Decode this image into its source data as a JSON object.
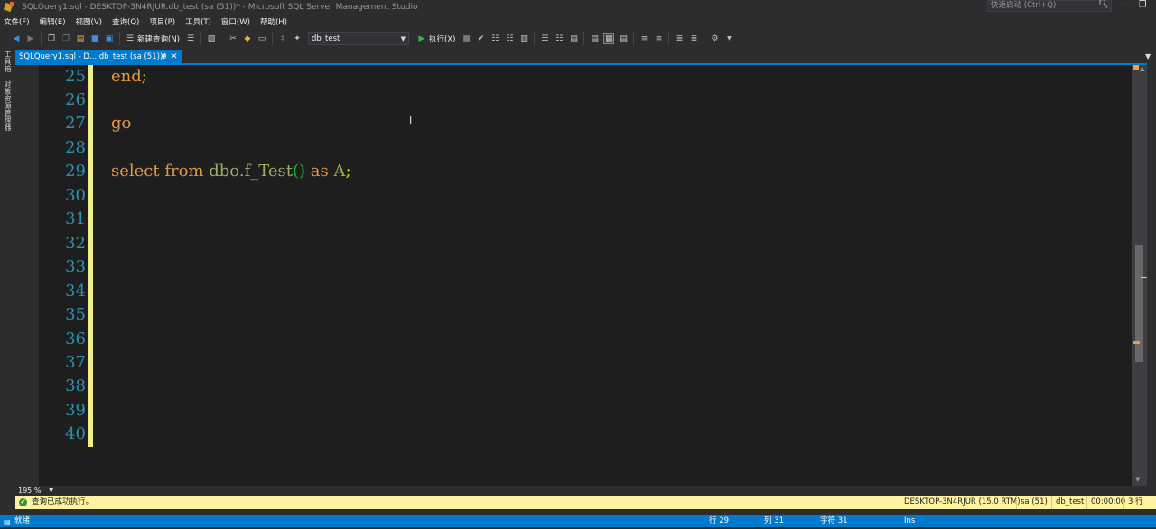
{
  "window": {
    "title": "SQLQuery1.sql - DESKTOP-3N4RJUR.db_test (sa (51))* - Microsoft SQL Server Management Studio",
    "quick_launch_placeholder": "快速启动 (Ctrl+Q)",
    "controls": {
      "minimize": "—",
      "restore": "❐"
    }
  },
  "menu": {
    "items": [
      "文件(F)",
      "编辑(E)",
      "视图(V)",
      "查询(Q)",
      "项目(P)",
      "工具(T)",
      "窗口(W)",
      "帮助(H)"
    ]
  },
  "toolbar": {
    "new_query_label": "新建查询(N)",
    "database_value": "db_test",
    "execute_label": "执行(X)"
  },
  "side_tabs": {
    "toolbox": "工具箱",
    "object_explorer": "对象资源管理器"
  },
  "document_tab": {
    "label": "SQLQuery1.sql - D....db_test (sa (51))*",
    "pin_glyph": "⊕",
    "close_glyph": "✕"
  },
  "editor": {
    "line_numbers": [
      "25",
      "26",
      "27",
      "28",
      "29",
      "30",
      "31",
      "32",
      "33",
      "34",
      "35",
      "36",
      "37",
      "38",
      "39",
      "40"
    ],
    "code": {
      "line25_kw": "end",
      "line25_semi": ";",
      "line27_kw": "go",
      "line29_select": "select",
      "line29_from": "from",
      "line29_obj": "dbo.",
      "line29_fn": "f_Test",
      "line29_parens": "()",
      "line29_as": "as",
      "line29_alias": "A",
      "line29_semi": ";"
    }
  },
  "zoom": {
    "value": "195 %"
  },
  "query_status": {
    "message": "查询已成功执行。",
    "server": "DESKTOP-3N4RJUR (15.0 RTM)",
    "user": "sa (51)",
    "database": "db_test",
    "elapsed": "00:00:00",
    "rows": "3 行"
  },
  "status_bar": {
    "ready": "就绪",
    "line": "行 29",
    "column": "列 31",
    "character": "字符 31",
    "mode": "Ins"
  },
  "colors": {
    "accent": "#007acc",
    "keyword": "#e59844",
    "line_number": "#2b91af",
    "change_bar": "#eeee8d",
    "query_status_bg": "#fff39f"
  }
}
